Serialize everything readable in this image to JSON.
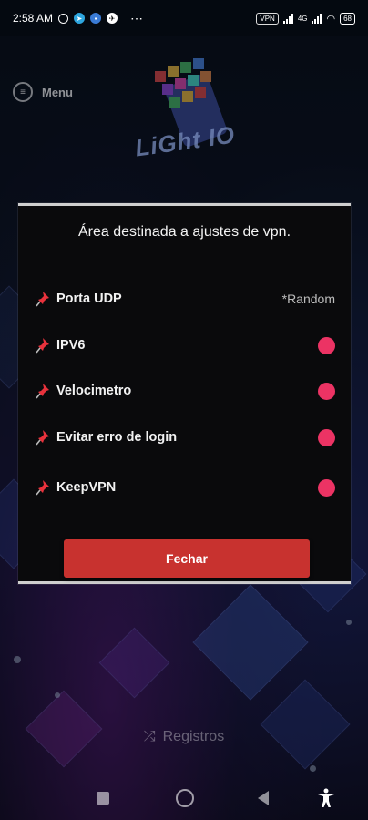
{
  "status_bar": {
    "time": "2:58 AM",
    "more": "⋯",
    "vpn_badge": "VPN",
    "network": "4G",
    "battery": "68"
  },
  "background": {
    "menu_label": "Menu",
    "logo_text": "LiGht IO",
    "footer_label": "Registros"
  },
  "dialog": {
    "title": "Área destinada a ajustes de vpn.",
    "settings": [
      {
        "label": "Porta UDP",
        "value": "*Random"
      },
      {
        "label": "IPV6",
        "toggle": true
      },
      {
        "label": "Velocimetro",
        "toggle": true
      },
      {
        "label": "Evitar erro de login",
        "toggle": true
      },
      {
        "label": "KeepVPN",
        "toggle": true
      }
    ],
    "close_label": "Fechar"
  },
  "colors": {
    "accent_toggle": "#ec3364",
    "close_button": "#c8322f"
  },
  "icons": {
    "pin": "pushpin-icon",
    "nav": [
      "square-icon",
      "circle-icon",
      "back-triangle-icon",
      "accessibility-icon"
    ]
  }
}
